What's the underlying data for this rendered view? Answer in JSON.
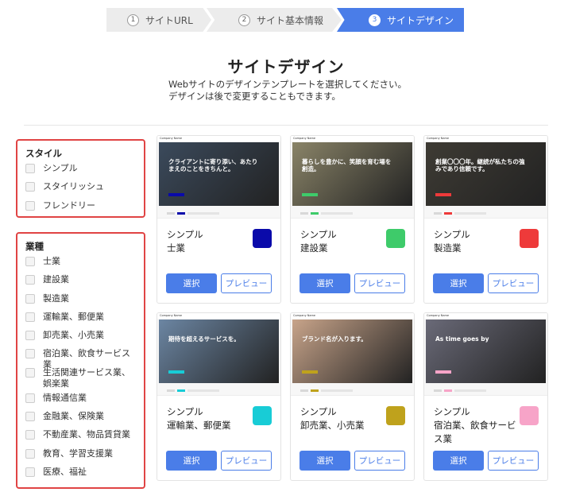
{
  "stepper": [
    {
      "num": "1",
      "label": "サイトURL"
    },
    {
      "num": "2",
      "label": "サイト基本情報"
    },
    {
      "num": "3",
      "label": "サイトデザイン"
    }
  ],
  "heading": {
    "title": "サイトデザイン",
    "desc_line1": "Webサイトのデザインテンプレートを選択してください。",
    "desc_line2": "デザインは後で変更することもできます。"
  },
  "filters": {
    "style_title": "スタイル",
    "style_options": [
      "シンプル",
      "スタイリッシュ",
      "フレンドリー"
    ],
    "industry_title": "業種",
    "industry_options": [
      "士業",
      "建設業",
      "製造業",
      "運輸業、郵便業",
      "卸売業、小売業",
      "宿泊業、飲食サービス業",
      "生活関連サービス業、娯楽業",
      "情報通信業",
      "金融業、保険業",
      "不動産業、物品賃貸業",
      "教育、学習支援業",
      "医療、福祉"
    ]
  },
  "cards": [
    {
      "style": "シンプル",
      "industry": "士業",
      "color": "#0a0aaa",
      "hero_text": "クライアントに寄り添い、あたりまえのことをきちんと。",
      "company": "Company Name",
      "hero_bg": "#3b4a5c"
    },
    {
      "style": "シンプル",
      "industry": "建設業",
      "color": "#3ecb6a",
      "hero_text": "暮らしを豊かに、笑顔を育む場を創造。",
      "company": "Company Name",
      "hero_bg": "#8a8468"
    },
    {
      "style": "シンプル",
      "industry": "製造業",
      "color": "#ee3a3a",
      "hero_text": "創業〇〇〇年。継続が私たちの強みであり信頼です。",
      "company": "Company Name",
      "hero_bg": "#3e3b34"
    },
    {
      "style": "シンプル",
      "industry": "運輸業、郵便業",
      "color": "#18ccd6",
      "hero_text": "期待を超えるサービスを。",
      "company": "Company Name",
      "hero_bg": "#6c86a3"
    },
    {
      "style": "シンプル",
      "industry": "卸売業、小売業",
      "color": "#bfa21c",
      "hero_text": "ブランド名が入ります。",
      "company": "Company Name",
      "hero_bg": "#c8a48a"
    },
    {
      "style": "シンプル",
      "industry": "宿泊業、飲食サービス業",
      "color": "#f7a4c8",
      "hero_text": "As time goes by",
      "company": "Company Name",
      "hero_bg": "#6a6a78"
    }
  ],
  "buttons": {
    "select": "選択",
    "preview": "プレビュー"
  },
  "colors": {
    "accent": "#4a7de8",
    "panel_border": "#e04444"
  }
}
